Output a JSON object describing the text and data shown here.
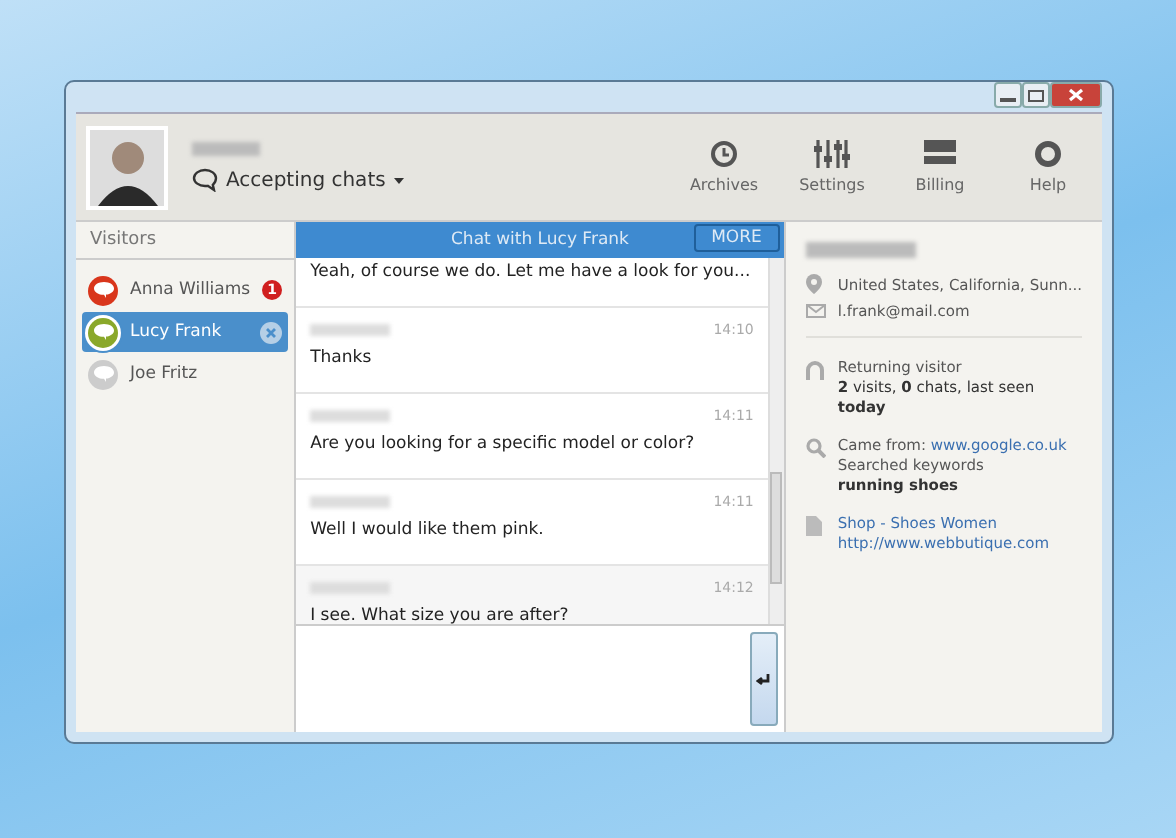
{
  "header": {
    "status": "Accepting chats",
    "toolbar": [
      {
        "label": "Archives"
      },
      {
        "label": "Settings"
      },
      {
        "label": "Billing"
      },
      {
        "label": "Help"
      }
    ]
  },
  "visitors": {
    "title": "Visitors",
    "items": [
      {
        "name": "Anna Williams",
        "color": "#d9361c",
        "selected": false,
        "badge": "1"
      },
      {
        "name": "Lucy Frank",
        "color": "#8aa82a",
        "selected": true
      },
      {
        "name": "Joe Fritz",
        "color": "#cccccc",
        "selected": false
      }
    ]
  },
  "chat": {
    "title": "Chat with Lucy Frank",
    "more": "MORE",
    "messages": [
      {
        "text": "Yeah, of course we do. Let me have a look for you..."
      },
      {
        "time": "14:10",
        "text": "Thanks"
      },
      {
        "time": "14:11",
        "text": "Are you looking for a specific model or color?"
      },
      {
        "time": "14:11",
        "text": "Well I would like them pink."
      },
      {
        "time": "14:12",
        "text": "I see. What size you are after?"
      }
    ]
  },
  "details": {
    "location": "United States, California, Sunn...",
    "email": "l.frank@mail.com",
    "visitor_type": "Returning visitor",
    "visits": "**2** visits, **0** chats, last seen **today**",
    "came_from_label": "Came from:",
    "came_from_link": "www.google.co.uk",
    "keywords_label": "Searched keywords",
    "keywords": "running shoes",
    "page_title": "Shop - Shoes Women",
    "page_url": "http://www.webbutique.com"
  }
}
